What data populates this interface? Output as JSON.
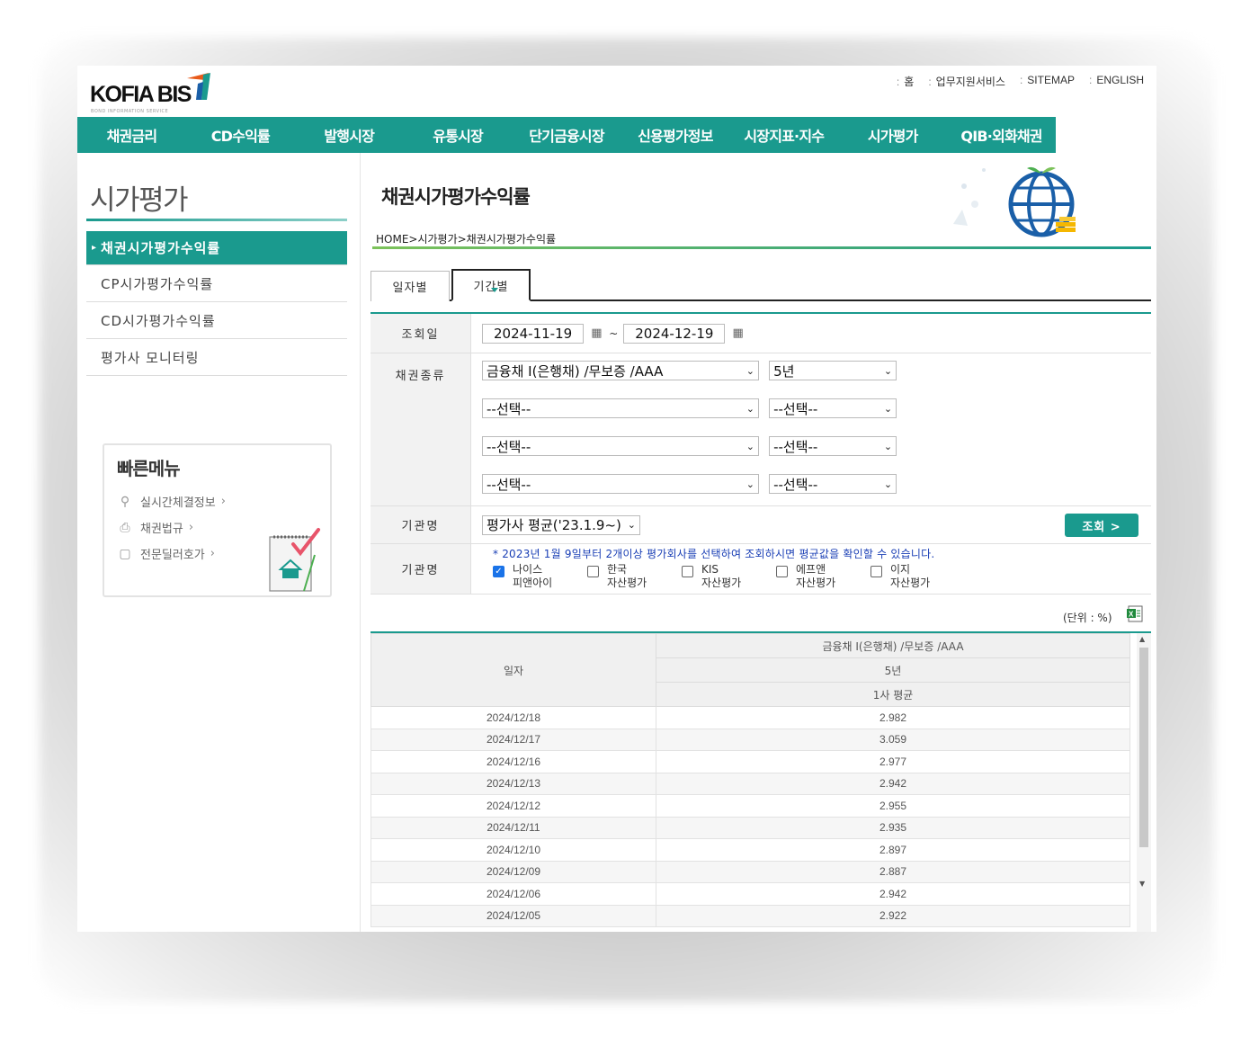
{
  "header": {
    "logo_text": "KOFIA BIS",
    "logo_subtext": "BOND INFORMATION SERVICE",
    "util_links": [
      "홈",
      "업무지원서비스",
      "SITEMAP",
      "ENGLISH"
    ]
  },
  "gnb": [
    "채권금리",
    "CD수익률",
    "발행시장",
    "유통시장",
    "단기금융시장",
    "신용평가정보",
    "시장지표·지수",
    "시가평가",
    "QIB·외화채권"
  ],
  "lnb": {
    "title": "시가평가",
    "items": [
      "채권시가평가수익률",
      "CP시가평가수익률",
      "CD시가평가수익률",
      "평가사 모니터링"
    ],
    "active_index": 0
  },
  "quick_menu": {
    "title": "빠른메뉴",
    "links": [
      {
        "label": "실시간체결정보",
        "icon": "search-icon"
      },
      {
        "label": "채권법규",
        "icon": "printer-icon"
      },
      {
        "label": "전문딜러호가",
        "icon": "document-icon"
      }
    ]
  },
  "content": {
    "title": "채권시가평가수익률",
    "breadcrumb": "HOME>시가평가>채권시가평가수익률",
    "tabs": [
      "일자별",
      "기간별"
    ],
    "active_tab": 1
  },
  "form": {
    "date_label": "조회일",
    "date_from": "2024-11-19",
    "date_sep": "~",
    "date_to": "2024-12-19",
    "bond_label": "채권종류",
    "bond_rows": [
      {
        "type": "금융채 I(은행채) /무보증 /AAA",
        "term": "5년"
      },
      {
        "type": "--선택--",
        "term": "--선택--"
      },
      {
        "type": "--선택--",
        "term": "--선택--"
      },
      {
        "type": "--선택--",
        "term": "--선택--"
      }
    ],
    "org_label1": "기관명",
    "org_select": "평가사 평균('23.1.9~)",
    "search_label": "조회 >",
    "org_label2": "기관명",
    "notice": "* 2023년 1월 9일부터 2개이상 평가회사를 선택하여 조회하시면 평균값을 확인할 수 있습니다.",
    "agencies": [
      {
        "line1": "나이스",
        "line2": "피앤아이",
        "checked": true
      },
      {
        "line1": "한국",
        "line2": "자산평가",
        "checked": false
      },
      {
        "line1": "KIS",
        "line2": "자산평가",
        "checked": false
      },
      {
        "line1": "에프앤",
        "line2": "자산평가",
        "checked": false
      },
      {
        "line1": "이지",
        "line2": "자산평가",
        "checked": false
      }
    ]
  },
  "unit_label": "(단위 : %)",
  "table": {
    "date_header": "일자",
    "bond_header": "금융채 I(은행채) /무보증 /AAA",
    "term_header": "5년",
    "agency_header": "1사 평균",
    "rows": [
      {
        "date": "2024/12/18",
        "value": "2.982"
      },
      {
        "date": "2024/12/17",
        "value": "3.059"
      },
      {
        "date": "2024/12/16",
        "value": "2.977"
      },
      {
        "date": "2024/12/13",
        "value": "2.942"
      },
      {
        "date": "2024/12/12",
        "value": "2.955"
      },
      {
        "date": "2024/12/11",
        "value": "2.935"
      },
      {
        "date": "2024/12/10",
        "value": "2.897"
      },
      {
        "date": "2024/12/09",
        "value": "2.887"
      },
      {
        "date": "2024/12/06",
        "value": "2.942"
      },
      {
        "date": "2024/12/05",
        "value": "2.922"
      }
    ]
  },
  "colors": {
    "brand_teal": "#1a9a8e",
    "notice_blue": "#1a3fb5"
  }
}
